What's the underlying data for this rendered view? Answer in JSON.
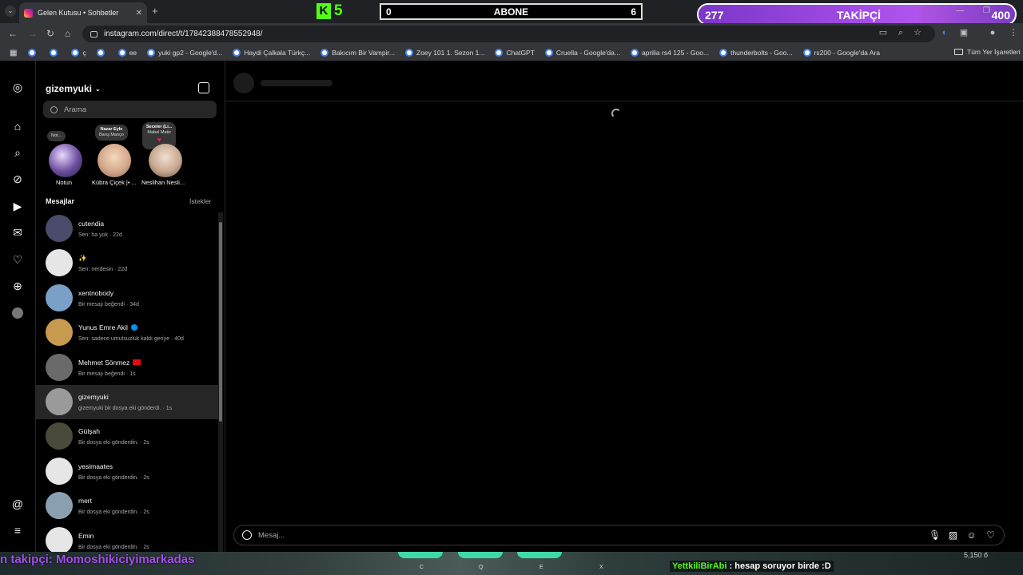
{
  "browser": {
    "tab_title": "Gelen Kutusu • Sohbetler",
    "url": "instagram.com/direct/t/17842388478552948/",
    "bookmarks": [
      {
        "label": ""
      },
      {
        "label": ""
      },
      {
        "label": "ç"
      },
      {
        "label": ""
      },
      {
        "label": "ee"
      },
      {
        "label": "yuki gp2 - Google'd..."
      },
      {
        "label": "Haydi Çalkala Türkç..."
      },
      {
        "label": "Bakıcım Bir Vampir..."
      },
      {
        "label": "Zoey 101 1. Sezon 1..."
      },
      {
        "label": "ChatGPT"
      },
      {
        "label": "Cruella - Google'da..."
      },
      {
        "label": "aprilia rs4 125 - Goo..."
      },
      {
        "label": "thunderbolts - Goo..."
      },
      {
        "label": "rs200 - Google'da Ara"
      }
    ],
    "all_bookmarks": "Tüm Yer İşaretleri"
  },
  "overlay": {
    "kick_count": "5",
    "abone": {
      "left": "0",
      "label": "ABONE",
      "right": "6"
    },
    "takipci": {
      "current": "277",
      "label": "TAKİPÇİ",
      "goal": "400",
      "progress_fraction": 0.6925
    },
    "ticker": "n takipçi: Momoshikiciyimarkadas",
    "chat": {
      "user": "YettkiliBirAbi",
      "text": " : hesap soruyor birde :D"
    },
    "keys": [
      "C",
      "Q",
      "E",
      "X"
    ],
    "corner": "5,150 ő"
  },
  "inbox": {
    "username": "gizemyuki",
    "search_placeholder": "Arama",
    "stories": [
      {
        "note": "Not...",
        "name": "Notun"
      },
      {
        "note_title": "Nazar Eyle",
        "note_sub": "Barış Manço",
        "name": "Kübra Çiçek |• ..."
      },
      {
        "note_title": "Seceler (Li...",
        "note_sub": "Mabel Matiz",
        "name": "Neslihan Nesli..."
      }
    ],
    "section_title": "Mesajlar",
    "requests_label": "İstekler",
    "conversations": [
      {
        "name": "cutendia",
        "preview": "Sen: ha yok · 22d",
        "color": "#4a4a6a",
        "badge": ""
      },
      {
        "name": "✨",
        "preview": "Sen: nerdesin · 22d",
        "color": "#e6e6e6",
        "badge": ""
      },
      {
        "name": "xentnobody",
        "preview": "Bir mesajı beğendi · 34d",
        "color": "#7aa0c8",
        "badge": ""
      },
      {
        "name": "Yunus Emre Akil",
        "preview": "Sen: sadece umutsuzluk kaldı geriye · 40d",
        "color": "#c89a50",
        "badge": "verified"
      },
      {
        "name": "Mehmet Sönmez",
        "preview": "Bir mesajı beğendi · 1s",
        "color": "#6a6a6a",
        "badge": "flag"
      },
      {
        "name": "gizemyuki",
        "preview": "gizemyuki bir dosya eki gönderdi. · 1s",
        "color": "#9a9a9a",
        "badge": ""
      },
      {
        "name": "Gülşah",
        "preview": "Bir dosya eki gönderdin. · 2s",
        "color": "#4a4a3a",
        "badge": ""
      },
      {
        "name": "yesimaates",
        "preview": "Bir dosya eki gönderdin. · 2s",
        "color": "#e6e6e6",
        "badge": ""
      },
      {
        "name": "mert",
        "preview": "Bir dosya eki gönderdin. · 2s",
        "color": "#8aa0b0",
        "badge": ""
      },
      {
        "name": "Emin",
        "preview": "Bir dosya eki gönderdin. · 2s",
        "color": "#e6e6e6",
        "badge": ""
      }
    ]
  },
  "composer": {
    "placeholder": "Mesaj..."
  }
}
